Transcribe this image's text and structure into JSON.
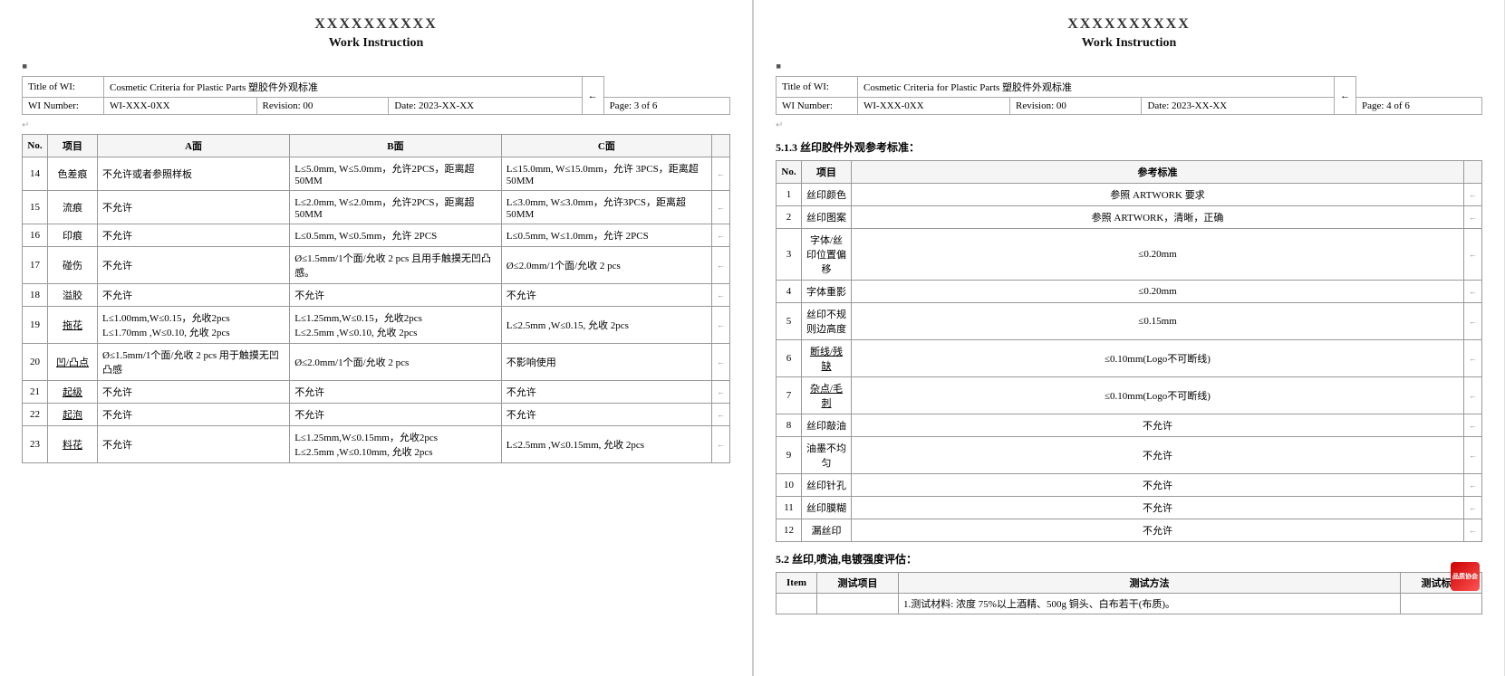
{
  "page3": {
    "title": "XXXXXXXXXX",
    "subtitle": "Work Instruction",
    "header": {
      "title_of_wi_label": "Title of WI:",
      "title_of_wi_value": "Cosmetic Criteria for Plastic Parts 塑胶件外观标准",
      "wi_number_label": "WI Number:",
      "wi_number_value": "WI-XXX-0XX",
      "revision_label": "Revision: 00",
      "date_label": "Date: 2023-XX-XX",
      "page_label": "Page: 3 of 6"
    },
    "rows": [
      {
        "no": "14",
        "item": "色差痕",
        "zone_a": "不允许或者参照样板",
        "zone_b": "L≤5.0mm, W≤5.0mm，允许2PCS，距离超 50MM",
        "zone_c": "L≤15.0mm, W≤15.0mm，允许 3PCS，距离超 50MM"
      },
      {
        "no": "15",
        "item": "流痕",
        "zone_a": "不允许",
        "zone_b": "L≤2.0mm, W≤2.0mm，允许2PCS，距离超 50MM",
        "zone_c": "L≤3.0mm, W≤3.0mm，允许3PCS，距离超 50MM"
      },
      {
        "no": "16",
        "item": "印痕",
        "zone_a": "不允许",
        "zone_b": "L≤0.5mm, W≤0.5mm，允许 2PCS",
        "zone_c": "L≤0.5mm, W≤1.0mm，允许 2PCS"
      },
      {
        "no": "17",
        "item": "碰伤",
        "zone_a": "不允许",
        "zone_b": "Ø≤1.5mm/1个面/允收 2 pcs 且用手触摸无凹凸感。",
        "zone_c": "Ø≤2.0mm/1个面/允收 2 pcs"
      },
      {
        "no": "18",
        "item": "溢胶",
        "zone_a": "不允许",
        "zone_b": "不允许",
        "zone_c": "不允许"
      },
      {
        "no": "19",
        "item": "拖花",
        "zone_a": "L≤1.00mm,W≤0.15，允收2pcs\nL≤1.70mm ,W≤0.10, 允收 2pcs",
        "zone_b": "L≤1.25mm,W≤0.15，允收2pcs\nL≤2.5mm ,W≤0.10, 允收 2pcs",
        "zone_c": "L≤2.5mm ,W≤0.15, 允收 2pcs"
      },
      {
        "no": "20",
        "item": "凹/凸点",
        "zone_a": "Ø≤1.5mm/1个面/允收 2 pcs 用于触摸无凹凸感",
        "zone_b": "Ø≤2.0mm/1个面/允收 2 pcs",
        "zone_c": "不影响使用"
      },
      {
        "no": "21",
        "item": "起级",
        "zone_a": "不允许",
        "zone_b": "不允许",
        "zone_c": "不允许"
      },
      {
        "no": "22",
        "item": "起泡",
        "zone_a": "不允许",
        "zone_b": "不允许",
        "zone_c": "不允许"
      },
      {
        "no": "23",
        "item": "料花",
        "zone_a": "不允许",
        "zone_b": "L≤1.25mm,W≤0.15mm，允收2pcs\nL≤2.5mm ,W≤0.10mm, 允收 2pcs",
        "zone_c": "L≤2.5mm ,W≤0.15mm, 允收 2pcs"
      }
    ]
  },
  "page4": {
    "title": "XXXXXXXXXX",
    "subtitle": "Work Instruction",
    "header": {
      "title_of_wi_label": "Title of WI:",
      "title_of_wi_value": "Cosmetic Criteria for Plastic Parts 塑胶件外观标准",
      "wi_number_label": "WI Number:",
      "wi_number_value": "WI-XXX-0XX",
      "revision_label": "Revision: 00",
      "date_label": "Date: 2023-XX-XX",
      "page_label": "Page: 4 of 6"
    },
    "section513": {
      "title": "5.1.3 丝印胶件外观参考标准：",
      "col_no": "No.",
      "col_item": "项目",
      "col_std": "参考标准",
      "rows": [
        {
          "no": "1",
          "item": "丝印颜色",
          "std": "参照 ARTWORK 要求"
        },
        {
          "no": "2",
          "item": "丝印图案",
          "std": "参照 ARTWORK，清晰，正确"
        },
        {
          "no": "3",
          "item": "字体/丝印位置偏移",
          "std": "≤0.20mm"
        },
        {
          "no": "4",
          "item": "字体重影",
          "std": "≤0.20mm"
        },
        {
          "no": "5",
          "item": "丝印不规则边高度",
          "std": "≤0.15mm"
        },
        {
          "no": "6",
          "item": "断线/残缺",
          "std": "≤0.10mm(Logo不可断线)"
        },
        {
          "no": "7",
          "item": "杂点/毛刺",
          "std": "≤0.10mm(Logo不可断线)"
        },
        {
          "no": "8",
          "item": "丝印敲油",
          "std": "不允许"
        },
        {
          "no": "9",
          "item": "油墨不均匀",
          "std": "不允许"
        },
        {
          "no": "10",
          "item": "丝印针孔",
          "std": "不允许"
        },
        {
          "no": "11",
          "item": "丝印膜糊",
          "std": "不允许"
        },
        {
          "no": "12",
          "item": "漏丝印",
          "std": "不允许"
        }
      ]
    },
    "section52": {
      "title": "5.2 丝印,喷油,电镀强度评估：",
      "col_item": "Item",
      "col_test": "测试项目",
      "col_method": "测试方法",
      "col_std": "测试标准",
      "rows": [
        {
          "item": "",
          "test": "",
          "method": "1.测试材料: 浓度 75%以上酒精、500g 铜头、白布若干(布质)。",
          "std": ""
        }
      ]
    }
  }
}
